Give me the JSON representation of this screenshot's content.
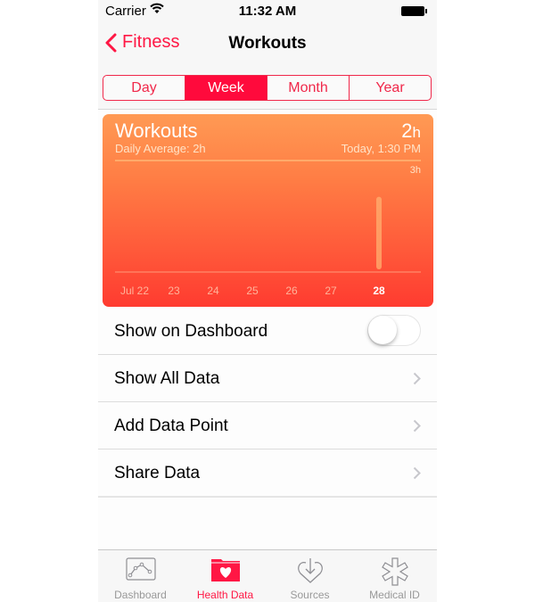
{
  "status_bar": {
    "carrier": "Carrier",
    "time": "11:32 AM"
  },
  "nav": {
    "back_label": "Fitness",
    "title": "Workouts"
  },
  "segments": [
    {
      "label": "Day",
      "active": false
    },
    {
      "label": "Week",
      "active": true
    },
    {
      "label": "Month",
      "active": false
    },
    {
      "label": "Year",
      "active": false
    }
  ],
  "card": {
    "title": "Workouts",
    "value": "2",
    "unit": "h",
    "daily_average": "Daily Average: 2h",
    "timestamp": "Today, 1:30 PM"
  },
  "chart_data": {
    "type": "bar",
    "title": "Workouts",
    "categories": [
      "Jul 22",
      "23",
      "24",
      "25",
      "26",
      "27",
      "28"
    ],
    "values": [
      0,
      0,
      0,
      0,
      0,
      0,
      2
    ],
    "highlighted_category": "28",
    "ylabel": "",
    "xlabel": "",
    "y_max_label": "3h",
    "ylim": [
      0,
      3
    ],
    "unit": "h"
  },
  "list": {
    "show_on_dashboard": {
      "label": "Show on Dashboard",
      "toggle_on": false
    },
    "items": [
      {
        "label": "Show All Data"
      },
      {
        "label": "Add Data Point"
      },
      {
        "label": "Share Data"
      }
    ]
  },
  "tabbar": {
    "items": [
      {
        "label": "Dashboard",
        "icon": "dashboard-chart-icon",
        "active": false
      },
      {
        "label": "Health Data",
        "icon": "health-data-folder-heart-icon",
        "active": true
      },
      {
        "label": "Sources",
        "icon": "sources-heart-download-icon",
        "active": false
      },
      {
        "label": "Medical ID",
        "icon": "medical-id-star-icon",
        "active": false
      }
    ]
  },
  "colors": {
    "accent": "#ff1744",
    "card_top": "#ff9a54",
    "card_bottom": "#ff3b30"
  }
}
